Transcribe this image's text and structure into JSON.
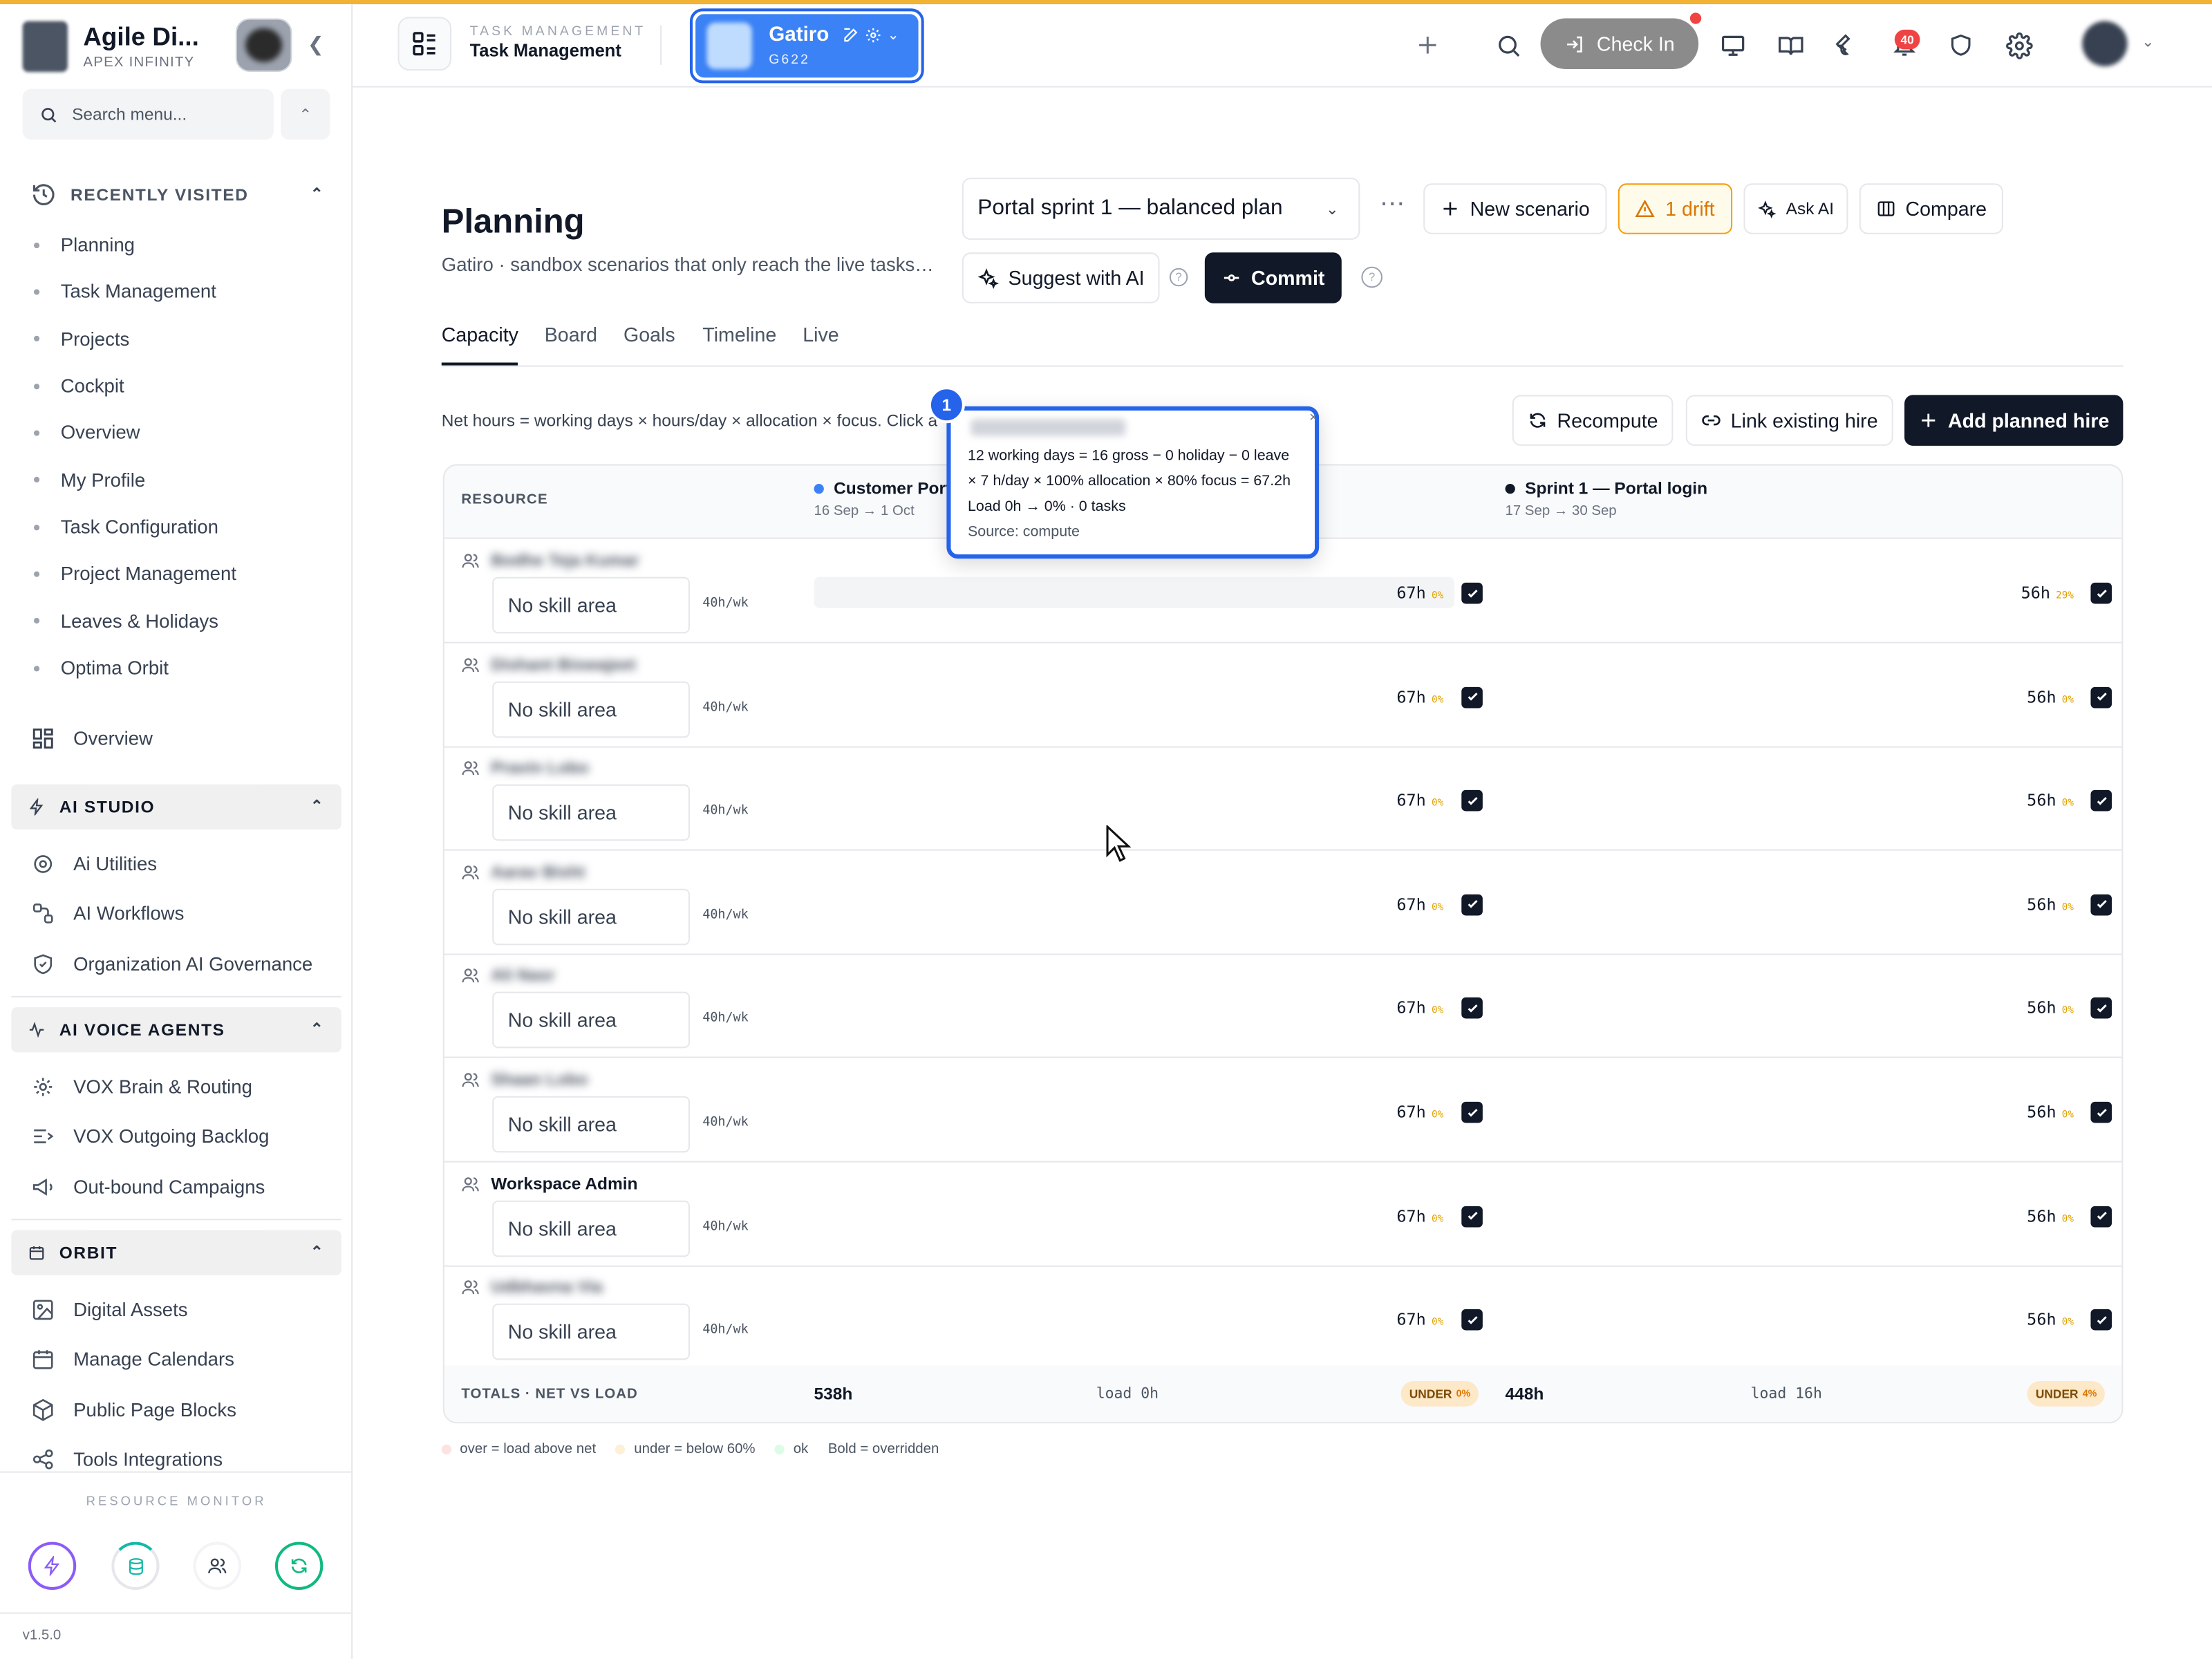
{
  "sidebar": {
    "brand_name": "Agile Di...",
    "brand_sub": "APEX INFINITY",
    "search_placeholder": "Search menu...",
    "recent_label": "RECENTLY VISITED",
    "recent": [
      "Planning",
      "Task Management",
      "Projects",
      "Cockpit",
      "Overview",
      "My Profile",
      "Task Configuration",
      "Project Management",
      "Leaves & Holidays",
      "Optima Orbit"
    ],
    "overview": "Overview",
    "ai_studio": {
      "label": "AI STUDIO",
      "items": [
        "Ai Utilities",
        "AI Workflows",
        "Organization AI Governance"
      ]
    },
    "ai_voice": {
      "label": "AI VOICE AGENTS",
      "items": [
        "VOX Brain & Routing",
        "VOX Outgoing Backlog",
        "Out-bound Campaigns"
      ]
    },
    "orbit": {
      "label": "ORBIT",
      "items": [
        "Digital Assets",
        "Manage Calendars",
        "Public Page Blocks",
        "Tools Integrations"
      ]
    },
    "resource_monitor": "RESOURCE MONITOR",
    "version": "v1.5.0"
  },
  "topbar": {
    "module_sub": "TASK MANAGEMENT",
    "module_title": "Task Management",
    "workspace_name": "Gatiro",
    "workspace_code": "G622",
    "check_in": "Check In",
    "notification_count": "40"
  },
  "page": {
    "title": "Planning",
    "subtitle": "Gatiro · sandbox scenarios that only reach the live tasks…",
    "scenario": "Portal sprint 1 — balanced plan",
    "new_scenario": "New scenario",
    "drift": "1 drift",
    "ask_ai": "Ask AI",
    "compare": "Compare",
    "suggest": "Suggest with AI",
    "commit": "Commit",
    "tabs": [
      "Capacity",
      "Board",
      "Goals",
      "Timeline",
      "Live"
    ],
    "hint": "Net hours = working days × hours/day × allocation × focus. Click a",
    "recompute": "Recompute",
    "link_hire": "Link existing hire",
    "add_hire": "Add planned hire"
  },
  "table": {
    "resource_header": "RESOURCE",
    "sprints": [
      {
        "name": "Customer Porta",
        "dates": "16 Sep → 1 Oct",
        "color": "#3b82f6"
      },
      {
        "name": "Sprint 1 — Portal login",
        "dates": "17 Sep → 30 Sep",
        "color": "#111827"
      }
    ],
    "rows": [
      {
        "name": "Bodhe Teja Kumar",
        "skill": "No skill area",
        "per_week": "40h/wk",
        "s1": "67h",
        "s1_pct": "0%",
        "s2": "56h",
        "s2_pct": "29%"
      },
      {
        "name": "Dishant Biswajeet",
        "skill": "No skill area",
        "per_week": "40h/wk",
        "s1": "67h",
        "s1_pct": "0%",
        "s2": "56h",
        "s2_pct": "0%"
      },
      {
        "name": "Pravin Lobo",
        "skill": "No skill area",
        "per_week": "40h/wk",
        "s1": "67h",
        "s1_pct": "0%",
        "s2": "56h",
        "s2_pct": "0%"
      },
      {
        "name": "Aarav Bisht",
        "skill": "No skill area",
        "per_week": "40h/wk",
        "s1": "67h",
        "s1_pct": "0%",
        "s2": "56h",
        "s2_pct": "0%"
      },
      {
        "name": "Ali Nasr",
        "skill": "No skill area",
        "per_week": "40h/wk",
        "s1": "67h",
        "s1_pct": "0%",
        "s2": "56h",
        "s2_pct": "0%"
      },
      {
        "name": "Shaan Lobo",
        "skill": "No skill area",
        "per_week": "40h/wk",
        "s1": "67h",
        "s1_pct": "0%",
        "s2": "56h",
        "s2_pct": "0%"
      },
      {
        "name": "Workspace Admin",
        "skill": "No skill area",
        "per_week": "40h/wk",
        "s1": "67h",
        "s1_pct": "0%",
        "s2": "56h",
        "s2_pct": "0%"
      },
      {
        "name": "Udbhavna Via",
        "skill": "No skill area",
        "per_week": "40h/wk",
        "s1": "67h",
        "s1_pct": "0%",
        "s2": "56h",
        "s2_pct": "0%"
      }
    ],
    "totals": {
      "label": "TOTALS · NET VS LOAD",
      "s1_net": "538h",
      "s1_load": "load 0h",
      "s1_status": "UNDER",
      "s1_pct": "0%",
      "s2_net": "448h",
      "s2_load": "load 16h",
      "s2_status": "UNDER",
      "s2_pct": "4%"
    }
  },
  "legend": [
    "over = load above net",
    "under = below 60%",
    "ok",
    "Bold = overridden"
  ],
  "tooltip": {
    "number": "1",
    "line1": "12 working days = 16 gross − 0 holiday − 0 leave",
    "line2": "× 7 h/day × 100% allocation × 80% focus = 67.2h",
    "line3": "Load 0h → 0% · 0 tasks",
    "line4": "Source: compute"
  }
}
